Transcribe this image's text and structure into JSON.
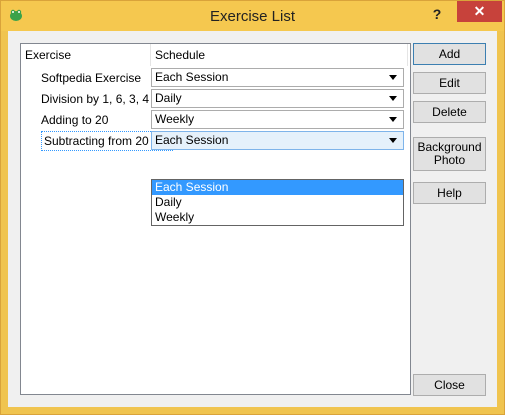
{
  "window": {
    "title": "Exercise List",
    "help_glyph": "?",
    "close_glyph": "✕",
    "app_icon": "frog-icon"
  },
  "grid": {
    "headers": [
      "Exercise",
      "Schedule"
    ],
    "rows": [
      {
        "exercise": "Softpedia Exercise",
        "schedule": "Each Session"
      },
      {
        "exercise": "Division by 1, 6, 3, 4",
        "schedule": "Daily"
      },
      {
        "exercise": "Adding to 20",
        "schedule": "Weekly"
      },
      {
        "exercise": "Subtracting from 20",
        "schedule": "Each Session"
      }
    ],
    "dropdown_options": [
      "Each Session",
      "Daily",
      "Weekly"
    ],
    "dropdown_selected": "Each Session"
  },
  "buttons": {
    "add": "Add",
    "edit": "Edit",
    "delete": "Delete",
    "background_photo_line1": "Background",
    "background_photo_line2": "Photo",
    "help": "Help",
    "close": "Close"
  },
  "colors": {
    "titlebar": "#f5c84f",
    "close": "#c7423b",
    "highlight": "#3399ff"
  }
}
